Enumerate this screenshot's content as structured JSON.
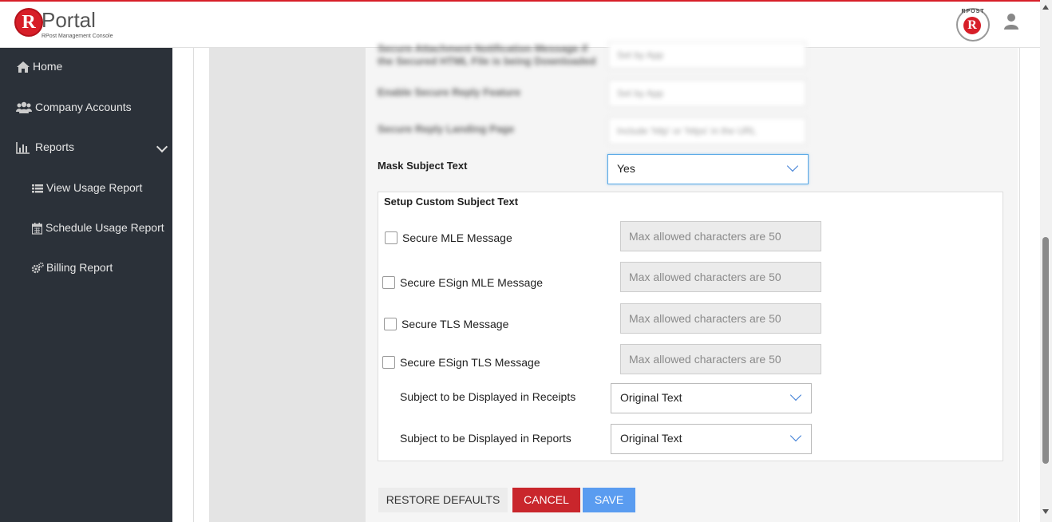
{
  "app": {
    "logo_text": "Portal",
    "logo_letter": "R",
    "logo_subtitle": "RPost Management Console",
    "badge_text": "RPOST",
    "badge_letter": "R"
  },
  "sidebar": {
    "items": [
      {
        "label": "Home",
        "icon": "home-icon"
      },
      {
        "label": "Company Accounts",
        "icon": "users-icon"
      },
      {
        "label": "Reports",
        "icon": "bar-chart-icon"
      },
      {
        "label": "View Usage Report",
        "icon": "list-icon"
      },
      {
        "label": "Schedule Usage Report",
        "icon": "calendar-icon"
      },
      {
        "label": "Billing Report",
        "icon": "gears-icon"
      }
    ]
  },
  "blurred": {
    "row1_label_a": "Secure Attachment Notification Message if",
    "row1_label_b": "the Secured HTML File is being Downloaded",
    "row1_value": "Set by App",
    "row2_label": "Enable Secure Reply Feature",
    "row2_value": "Set by App",
    "row3_label": "Secure Reply Landing Page",
    "row3_value": "Include 'http' or 'https' in the URL"
  },
  "mask_subject": {
    "label": "Mask Subject Text",
    "value": "Yes"
  },
  "custom_subject": {
    "title": "Setup Custom Subject Text",
    "rows": [
      {
        "label": "Secure MLE Message",
        "placeholder": "Max allowed characters are 50"
      },
      {
        "label": "Secure ESign MLE Message",
        "placeholder": "Max allowed characters are 50"
      },
      {
        "label": "Secure TLS Message",
        "placeholder": "Max allowed characters are 50"
      },
      {
        "label": "Secure ESign TLS Message",
        "placeholder": "Max allowed characters are 50"
      }
    ],
    "receipts_label": "Subject to be Displayed in Receipts",
    "receipts_value": "Original Text",
    "reports_label": "Subject to be Displayed in Reports",
    "reports_value": "Original Text"
  },
  "buttons": {
    "restore": "RESTORE DEFAULTS",
    "cancel": "CANCEL",
    "save": "SAVE"
  },
  "colors": {
    "brand_red": "#d71e28",
    "sidebar_bg": "#2b3139",
    "cancel_red": "#c9262c",
    "save_blue": "#5a9cf0"
  }
}
